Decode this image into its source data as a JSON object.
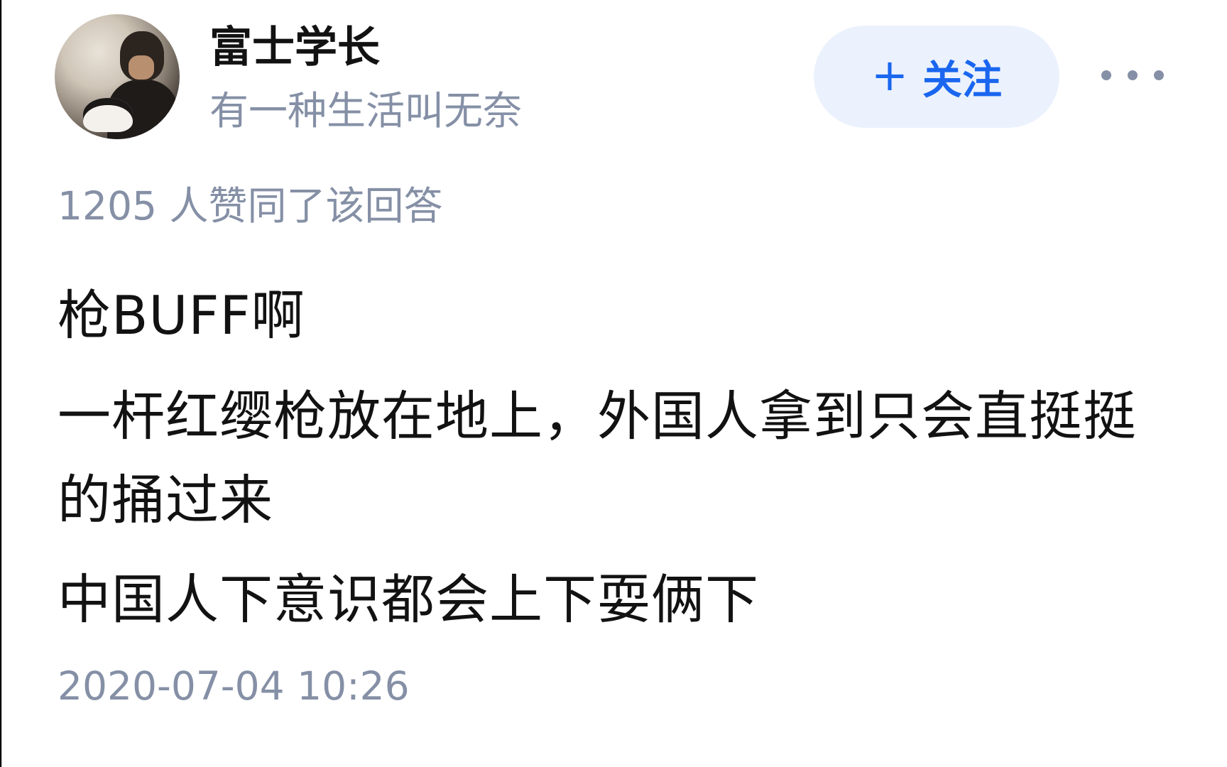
{
  "author": {
    "name": "富士学长",
    "bio": "有一种生活叫无奈"
  },
  "actions": {
    "follow_label": "关注",
    "follow_icon": "plus-icon",
    "more_icon": "more-icon"
  },
  "approval": {
    "text": "1205 人赞同了该回答"
  },
  "answer": {
    "lines": [
      "枪BUFF啊",
      "一杆红缨枪放在地上，外国人拿到只会直挺挺的捅过来",
      "中国人下意识都会上下耍俩下"
    ]
  },
  "meta": {
    "timestamp": "2020-07-04 10:26"
  },
  "colors": {
    "primary_text": "#121212",
    "secondary_text": "#8590a6",
    "follow_bg": "#ebf2fd",
    "follow_text": "#1a66ef",
    "background": "#ffffff"
  }
}
